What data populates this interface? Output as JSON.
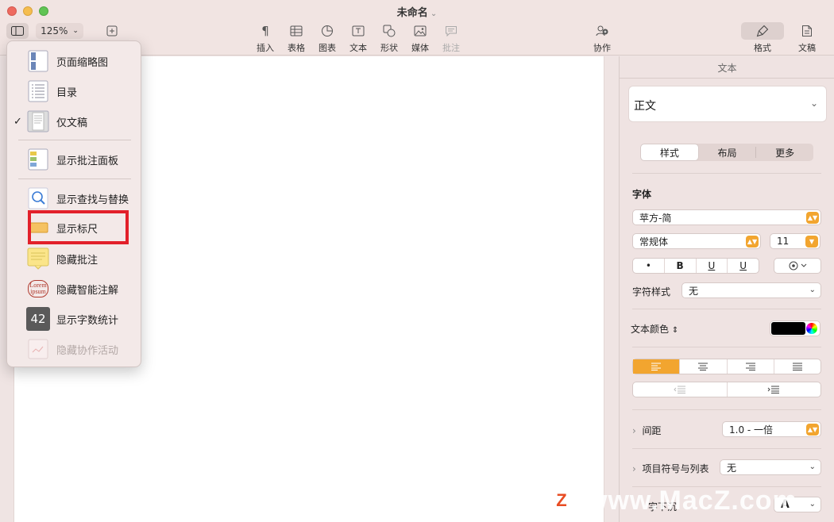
{
  "window": {
    "title": "未命名",
    "zoom": "125%"
  },
  "toolbar": {
    "tools": [
      {
        "id": "insert",
        "label": "插入",
        "icon": "paragraph-icon"
      },
      {
        "id": "table",
        "label": "表格",
        "icon": "table-icon"
      },
      {
        "id": "chart",
        "label": "图表",
        "icon": "chart-icon"
      },
      {
        "id": "text",
        "label": "文本",
        "icon": "textbox-icon"
      },
      {
        "id": "shape",
        "label": "形状",
        "icon": "shape-icon"
      },
      {
        "id": "media",
        "label": "媒体",
        "icon": "media-icon"
      },
      {
        "id": "comment",
        "label": "批注",
        "icon": "comment-icon",
        "disabled": true
      }
    ],
    "collaborate": "协作",
    "format": "格式",
    "document": "文稿"
  },
  "menu": {
    "items": [
      {
        "label": "页面缩略图",
        "icon": "page-thumbnails-icon",
        "checked": false
      },
      {
        "label": "目录",
        "icon": "table-of-contents-icon",
        "checked": false
      },
      {
        "label": "仅文稿",
        "icon": "document-only-icon",
        "checked": true
      },
      {
        "label": "显示批注面板",
        "icon": "comments-pane-icon",
        "checked": false
      },
      {
        "label": "显示查找与替换",
        "icon": "search-icon",
        "checked": false
      },
      {
        "label": "显示标尺",
        "icon": "ruler-icon",
        "checked": false
      },
      {
        "label": "隐藏批注",
        "icon": "note-icon",
        "checked": false
      },
      {
        "label": "隐藏智能注解",
        "icon": "smart-annotation-icon",
        "checked": false,
        "icon_text": "Lorem ipsum"
      },
      {
        "label": "显示字数统计",
        "icon": "word-count-icon",
        "checked": false,
        "icon_text": "42"
      },
      {
        "label": "隐藏协作活动",
        "icon": "collaboration-activity-icon",
        "checked": false,
        "disabled": true
      }
    ],
    "check_mark": "✓"
  },
  "inspector": {
    "header": "文本",
    "paragraph_style": "正文",
    "tabs": [
      "样式",
      "布局",
      "更多"
    ],
    "active_tab": "样式",
    "font_label": "字体",
    "font_family": "苹方-简",
    "font_weight": "常规体",
    "font_size": "11",
    "style_buttons": [
      "•",
      "B",
      "U",
      "U"
    ],
    "char_style_label": "字符样式",
    "char_style_value": "无",
    "text_color_label": "文本颜色",
    "text_color": "#000000",
    "accent_color": "#f2a52f",
    "spacing_label": "间距",
    "spacing_value": "1.0 - 一倍",
    "bullets_label": "项目符号与列表",
    "bullets_value": "无",
    "bottom_label": "字下沉",
    "bottom_value": "A"
  },
  "watermark": {
    "logo": "Z",
    "text": "www.MacZ.com"
  }
}
